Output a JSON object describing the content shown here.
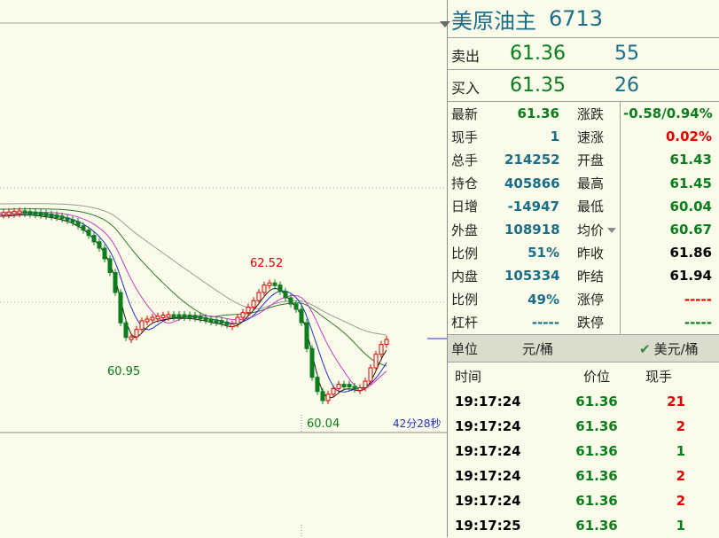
{
  "chart": {
    "high_label": "62.52",
    "low_label_left": "60.95",
    "low_label_right": "60.04",
    "countdown": "42分28秒",
    "colors": {
      "up": "#e00000",
      "down": "#0a7d1d",
      "ma5": "#1a1a1a",
      "ma10": "#2232c8",
      "ma20": "#c43cc4",
      "ma40": "#2a7a2a",
      "ma60": "#9a9a9a",
      "bg": "#fbfbe9"
    }
  },
  "header": {
    "name": "美原油主",
    "code": "6713"
  },
  "book": {
    "sell": {
      "label": "卖出",
      "price": "61.36",
      "volume": "55"
    },
    "buy": {
      "label": "买入",
      "price": "61.35",
      "volume": "26"
    }
  },
  "stats": [
    {
      "l1": "最新",
      "v1": "61.36",
      "c1": "g",
      "l2": "涨跌",
      "v2": "-0.58/0.94%",
      "c2": "g"
    },
    {
      "l1": "现手",
      "v1": "1",
      "c1": "b",
      "l2": "速涨",
      "v2": "0.02%",
      "c2": "r"
    },
    {
      "l1": "总手",
      "v1": "214252",
      "c1": "b",
      "l2": "开盘",
      "v2": "61.43",
      "c2": "g"
    },
    {
      "l1": "持仓",
      "v1": "405866",
      "c1": "b",
      "l2": "最高",
      "v2": "61.45",
      "c2": "g"
    },
    {
      "l1": "日增",
      "v1": "-14947",
      "c1": "b",
      "l2": "最低",
      "v2": "60.04",
      "c2": "g"
    },
    {
      "l1": "外盘",
      "v1": "108918",
      "c1": "b",
      "l2": "均价",
      "v2": "60.67",
      "c2": "g"
    },
    {
      "l1": "比例",
      "v1": "51%",
      "c1": "b",
      "l2": "昨收",
      "v2": "61.86",
      "c2": "k"
    },
    {
      "l1": "内盘",
      "v1": "105334",
      "c1": "b",
      "l2": "昨结",
      "v2": "61.94",
      "c2": "k"
    },
    {
      "l1": "比例",
      "v1": "49%",
      "c1": "b",
      "l2": "涨停",
      "v2": "-----",
      "c2": "r"
    },
    {
      "l1": "杠杆",
      "v1": "-----",
      "c1": "b",
      "l2": "跌停",
      "v2": "-----",
      "c2": "g"
    }
  ],
  "unit": {
    "label": "单位",
    "value": "元/桶",
    "currency": "美元/桶"
  },
  "ticks": {
    "headers": [
      "时间",
      "价位",
      "现手"
    ],
    "rows": [
      {
        "time": "19:17:24",
        "price": "61.36",
        "vol": "21"
      },
      {
        "time": "19:17:24",
        "price": "61.36",
        "vol": "2"
      },
      {
        "time": "19:17:24",
        "price": "61.36",
        "vol": "1"
      },
      {
        "time": "19:17:24",
        "price": "61.36",
        "vol": "2"
      },
      {
        "time": "19:17:24",
        "price": "61.36",
        "vol": "2"
      },
      {
        "time": "19:17:25",
        "price": "61.36",
        "vol": "1"
      }
    ]
  }
}
